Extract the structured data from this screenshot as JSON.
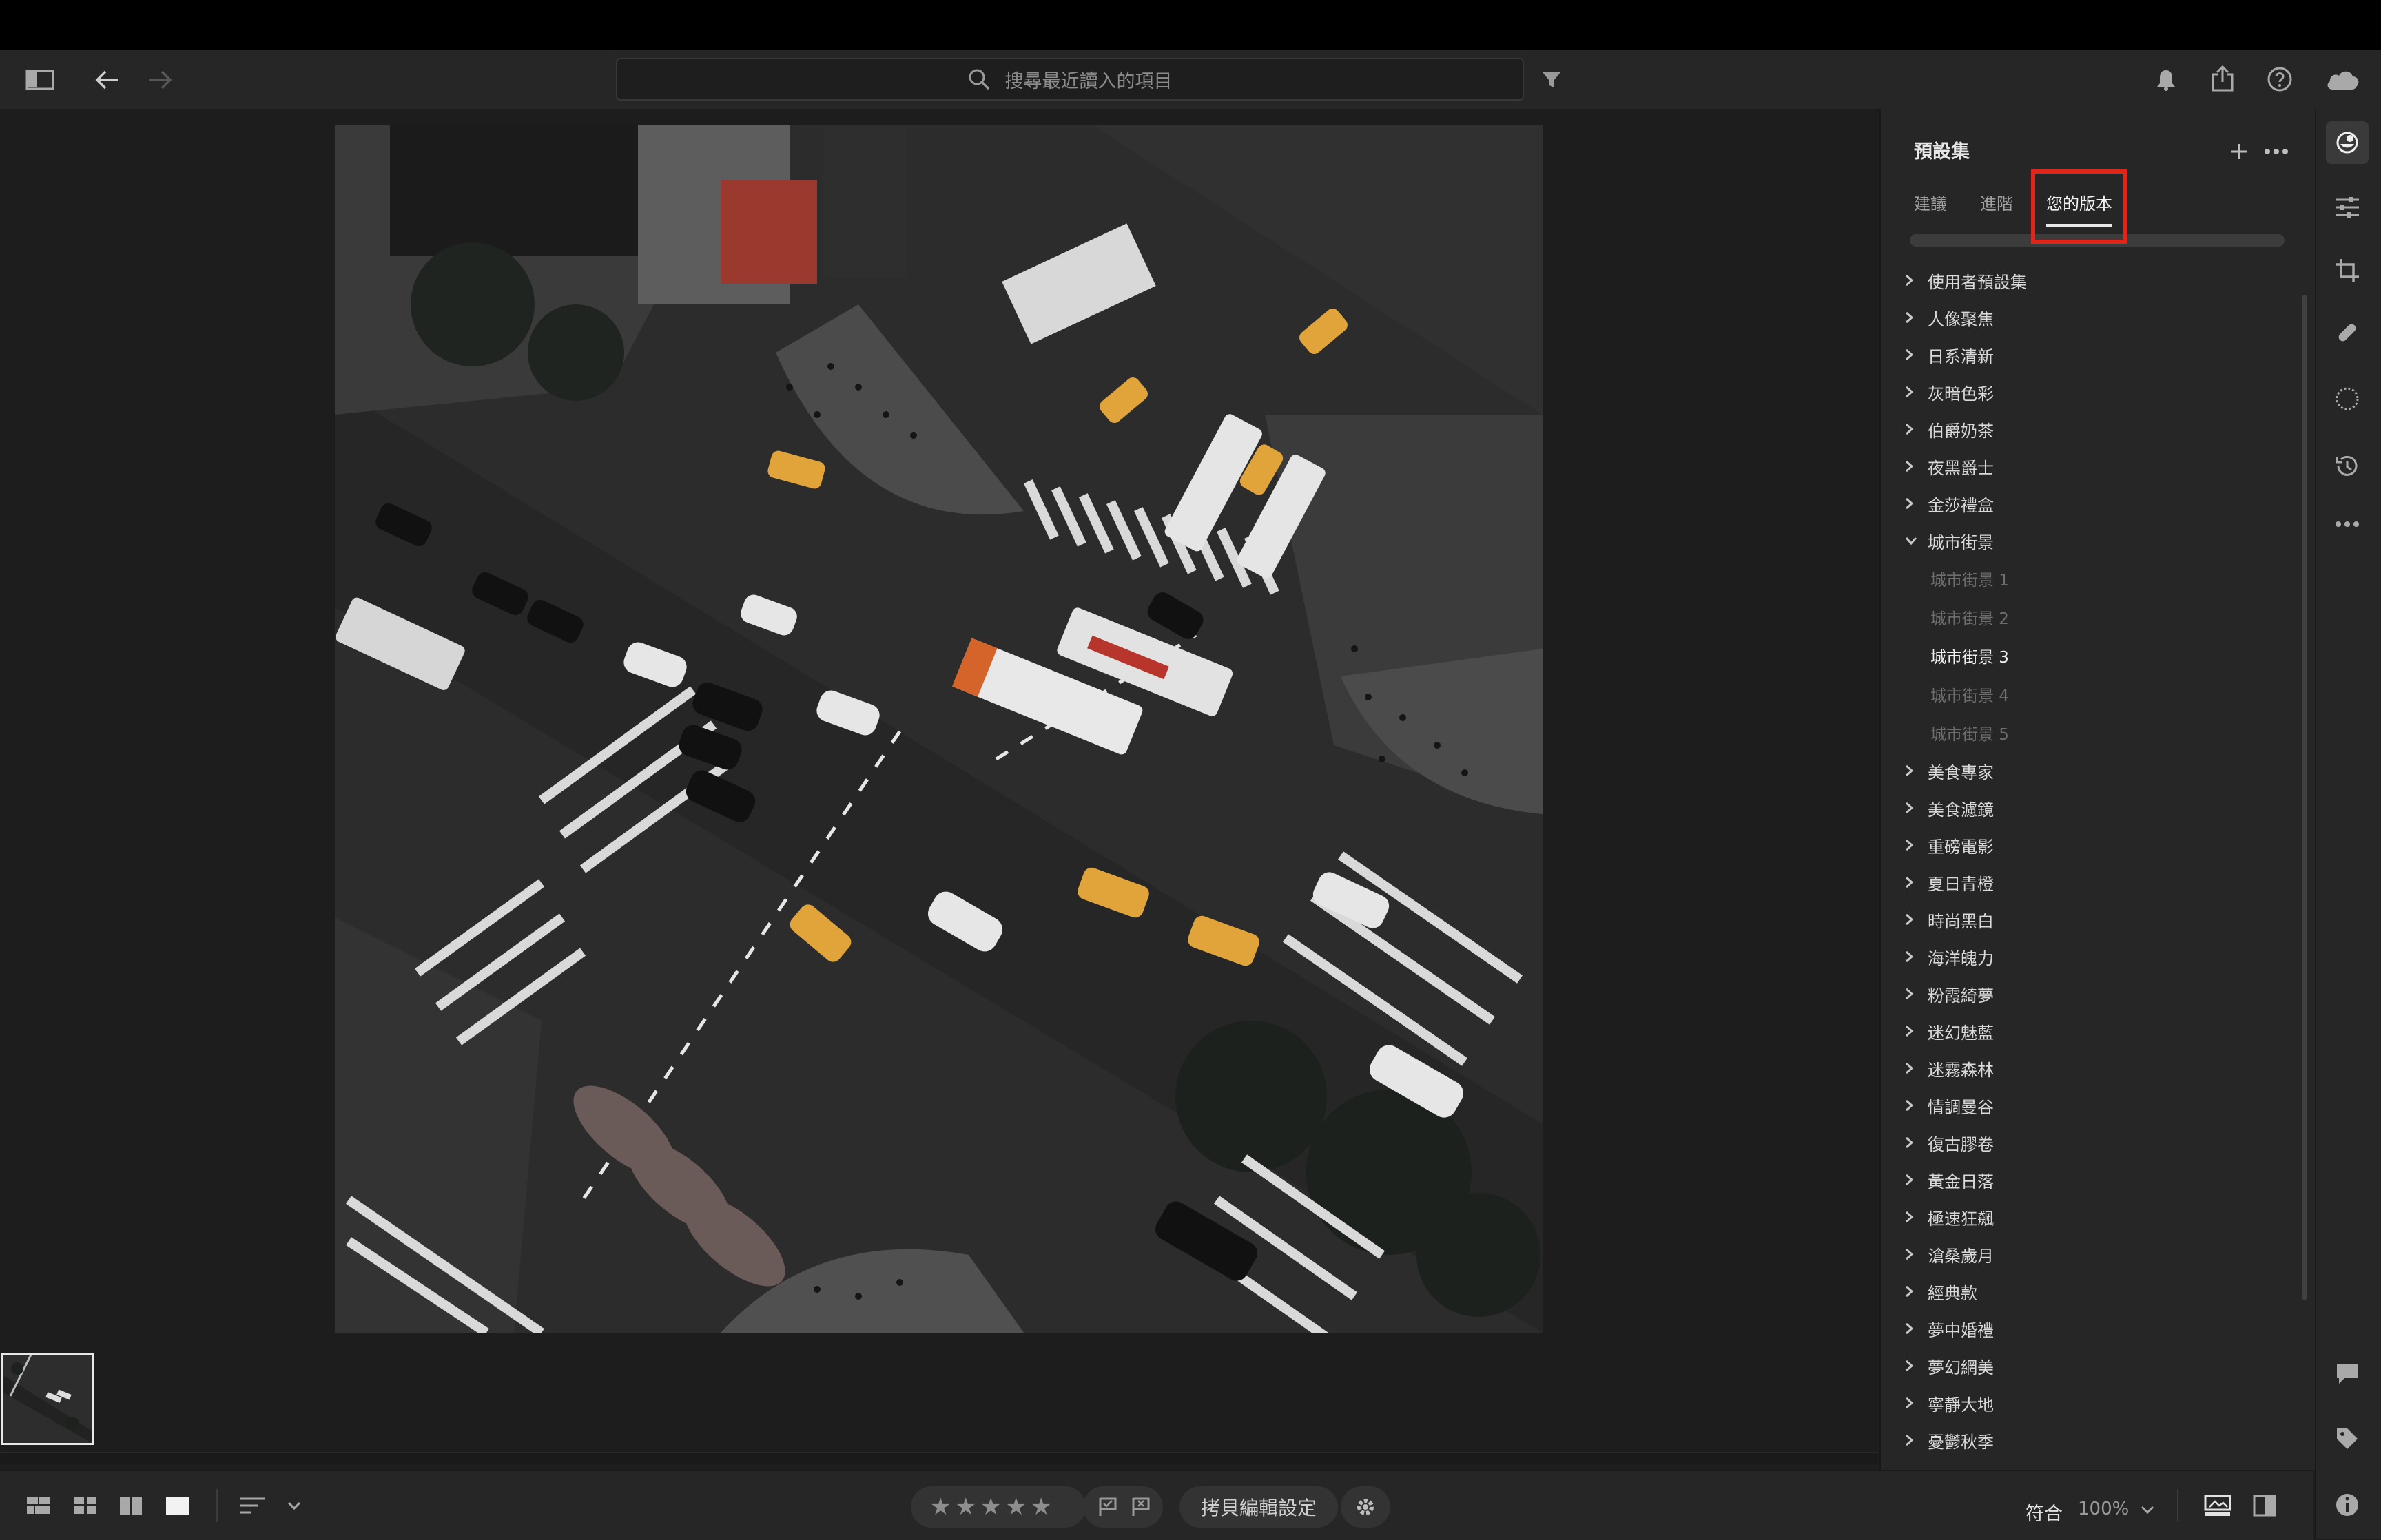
{
  "search": {
    "placeholder": "搜尋最近讀入的項目"
  },
  "presets": {
    "title": "預設集",
    "tabs": [
      {
        "label": "建議"
      },
      {
        "label": "進階"
      },
      {
        "label": "您的版本"
      }
    ],
    "active_tab": "您的版本",
    "groups_top": [
      {
        "label": "使用者預設集"
      },
      {
        "label": "人像聚焦"
      },
      {
        "label": "日系清新"
      },
      {
        "label": "灰暗色彩"
      },
      {
        "label": "伯爵奶茶"
      },
      {
        "label": "夜黑爵士"
      },
      {
        "label": "金莎禮盒"
      }
    ],
    "expanded_group": {
      "label": "城市街景",
      "items": [
        {
          "label": "城市街景 1"
        },
        {
          "label": "城市街景 2"
        },
        {
          "label": "城市街景 3"
        },
        {
          "label": "城市街景 4"
        },
        {
          "label": "城市街景 5"
        }
      ],
      "selected": "城市街景 3"
    },
    "groups_bottom": [
      {
        "label": "美食專家"
      },
      {
        "label": "美食濾鏡"
      },
      {
        "label": "重磅電影"
      },
      {
        "label": "夏日青橙"
      },
      {
        "label": "時尚黑白"
      },
      {
        "label": "海洋魄力"
      },
      {
        "label": "粉霞綺夢"
      },
      {
        "label": "迷幻魅藍"
      },
      {
        "label": "迷霧森林"
      },
      {
        "label": "情調曼谷"
      },
      {
        "label": "復古膠卷"
      },
      {
        "label": "黃金日落"
      },
      {
        "label": "極速狂飆"
      },
      {
        "label": "滄桑歲月"
      },
      {
        "label": "經典款"
      },
      {
        "label": "夢中婚禮"
      },
      {
        "label": "夢幻網美"
      },
      {
        "label": "寧靜大地"
      },
      {
        "label": "憂鬱秋季"
      }
    ]
  },
  "bottom": {
    "rating_stars": 5,
    "copy_settings_label": "拷貝編輯設定",
    "fit_label": "符合",
    "zoom_label": "100%"
  },
  "colors": {
    "accent_highlight": "#e0261b",
    "panel_bg": "#262626",
    "canvas_bg": "#1d1d1d"
  },
  "icons": [
    "sidebar-toggle-icon",
    "back-arrow-icon",
    "forward-arrow-icon",
    "search-icon",
    "filter-icon",
    "bell-icon",
    "share-icon",
    "help-icon",
    "cloud-icon",
    "add-icon",
    "more-icon",
    "presets-icon",
    "edit-sliders-icon",
    "crop-icon",
    "healing-icon",
    "masking-icon",
    "history-icon",
    "more-horizontal-icon",
    "comment-icon",
    "tag-icon",
    "info-icon",
    "chevron-right-icon",
    "chevron-down-icon",
    "star-icon",
    "flag-pick-icon",
    "flag-reject-icon",
    "gear-icon",
    "grid-icon",
    "square-grid-icon",
    "compare-icon",
    "detail-icon",
    "sort-icon",
    "before-after-icon"
  ]
}
